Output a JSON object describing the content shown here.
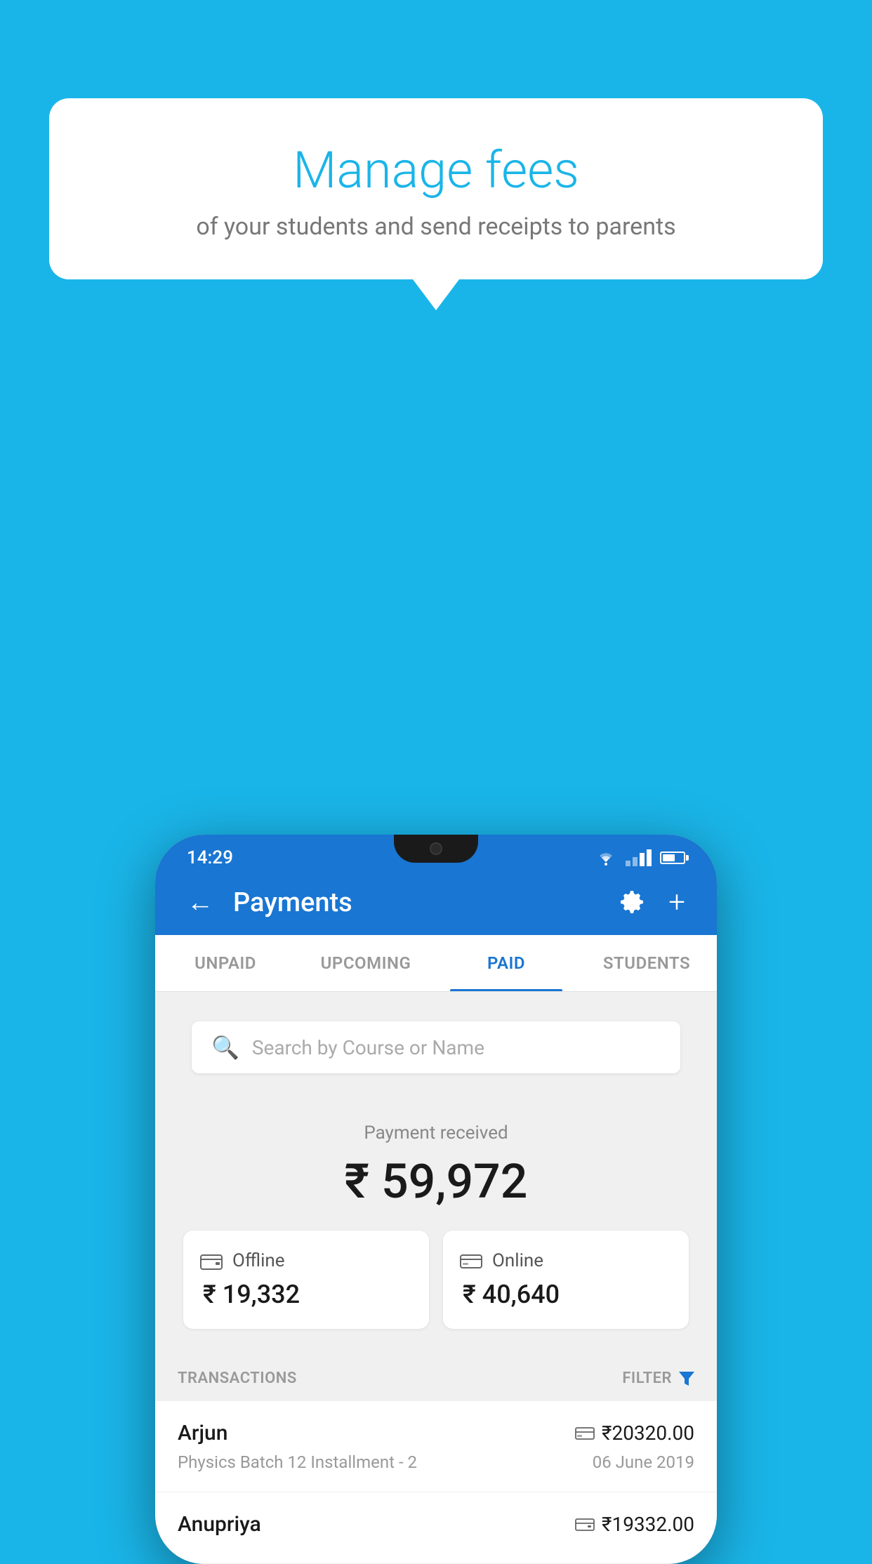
{
  "background_color": "#1ab5e8",
  "speech_bubble": {
    "title": "Manage fees",
    "subtitle": "of your students and send receipts to parents"
  },
  "phone": {
    "status_bar": {
      "time": "14:29"
    },
    "app_bar": {
      "title": "Payments",
      "back_label": "←",
      "plus_label": "+"
    },
    "tabs": [
      {
        "label": "UNPAID",
        "active": false
      },
      {
        "label": "UPCOMING",
        "active": false
      },
      {
        "label": "PAID",
        "active": true
      },
      {
        "label": "STUDENTS",
        "active": false
      }
    ],
    "search": {
      "placeholder": "Search by Course or Name"
    },
    "payment_summary": {
      "label": "Payment received",
      "amount": "₹ 59,972",
      "offline": {
        "type": "Offline",
        "amount": "₹ 19,332"
      },
      "online": {
        "type": "Online",
        "amount": "₹ 40,640"
      }
    },
    "transactions": {
      "label": "TRANSACTIONS",
      "filter_label": "FILTER",
      "rows": [
        {
          "name": "Arjun",
          "detail": "Physics Batch 12 Installment - 2",
          "amount": "₹20320.00",
          "date": "06 June 2019",
          "icon_type": "online"
        },
        {
          "name": "Anupriya",
          "detail": "",
          "amount": "₹19332.00",
          "date": "",
          "icon_type": "offline"
        }
      ]
    }
  }
}
